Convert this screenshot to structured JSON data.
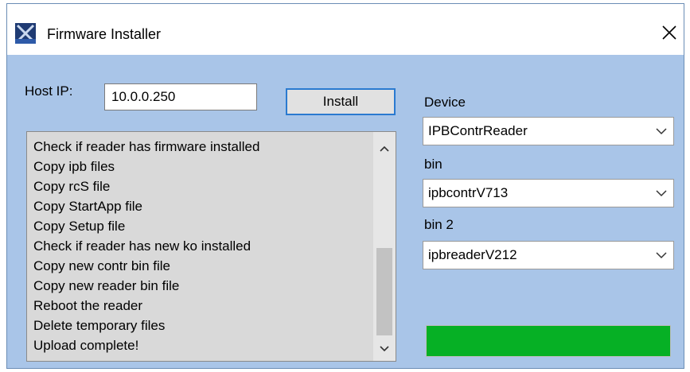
{
  "window": {
    "title": "Firmware Installer"
  },
  "host": {
    "label": "Host IP:",
    "value": "10.0.0.250"
  },
  "install_button": {
    "label": "Install"
  },
  "log": {
    "lines": [
      "Check if reader has firmware installed",
      "Copy ipb files",
      "Copy rcS file",
      "Copy StartApp file",
      "Copy Setup file",
      "Check if reader has new ko installed",
      "Copy new contr bin file",
      "Copy new reader bin file",
      "Reboot the reader",
      "Delete temporary files",
      "Upload complete!"
    ]
  },
  "device": {
    "label": "Device",
    "value": "IPBContrReader"
  },
  "bin": {
    "label": "bin",
    "value": "ipbcontrV713"
  },
  "bin2": {
    "label": "bin 2",
    "value": "ipbreaderV212"
  },
  "progress": {
    "value_percent": 100,
    "color": "#06b025"
  },
  "colors": {
    "client_background": "#a9c5e8",
    "button_focus_border": "#2a7ad0"
  },
  "icons": {
    "app": "app-logo-icon",
    "close": "close-icon",
    "combo": "chevron-down-icon",
    "scroll_up": "chevron-up-icon",
    "scroll_down": "chevron-down-icon"
  }
}
